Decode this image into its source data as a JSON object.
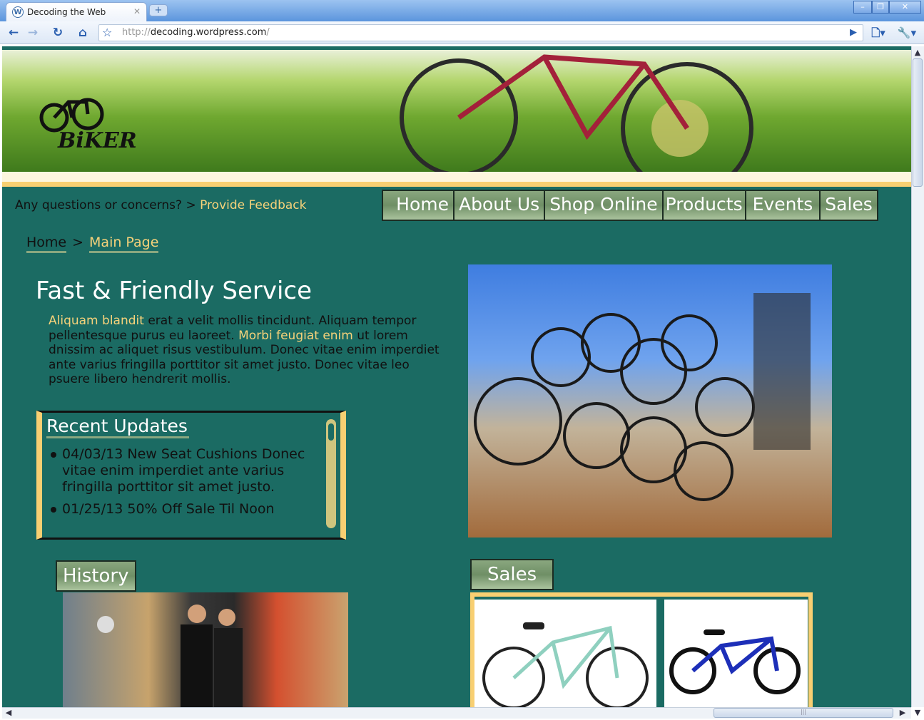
{
  "browser": {
    "tab_title": "Decoding the Web",
    "url_prefix": "http://",
    "url_host": "decoding.wordpress.com",
    "url_suffix": "/"
  },
  "site": {
    "logo_text": "BIKER",
    "question": "Any questions or concerns?",
    "question_sep": ">",
    "feedback_link": "Provide Feedback",
    "nav": [
      "Home",
      "About Us",
      "Shop Online",
      "Products",
      "Events",
      "Sales"
    ],
    "breadcrumb": {
      "home": "Home",
      "sep": ">",
      "current": "Main Page"
    },
    "heading": "Fast & Friendly Service",
    "intro": {
      "link1": "Aliquam blandit",
      "text1": " erat a velit mollis tincidunt. Aliquam tempor pellentesque purus eu laoreet. ",
      "link2": "Morbi feugiat enim",
      "text2": " ut lorem dnissim ac aliquet risus vestibulum. Donec vitae enim imperdiet ante varius fringilla porttitor sit amet justo. Donec vitae leo psuere libero hendrerit mollis."
    },
    "updates": {
      "title": "Recent Updates",
      "items": [
        "04/03/13 New Seat Cushions Donec vitae enim imperdiet ante varius fringilla porttitor sit amet justo.",
        "01/25/13 50% Off Sale Til Noon"
      ]
    },
    "history_title": "History",
    "sales_title": "Sales"
  },
  "colors": {
    "teal": "#1b6b63",
    "gold": "#f8cf72",
    "link": "#f6d27a",
    "nav_green": "#7d9b72"
  }
}
